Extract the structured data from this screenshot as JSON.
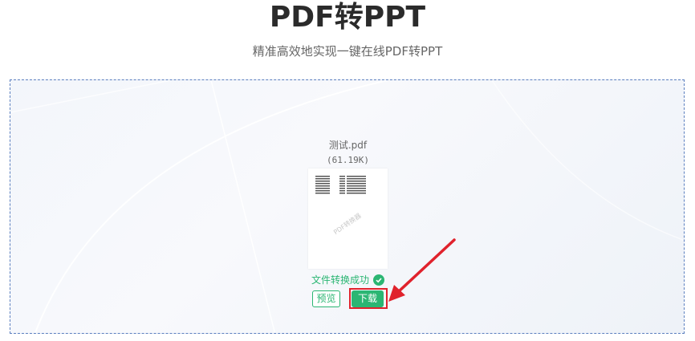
{
  "header": {
    "title": "PDF转PPT",
    "subtitle": "精准高效地实现一键在线PDF转PPT"
  },
  "file": {
    "name": "测试.pdf",
    "size": "(61.19K)",
    "watermark": "PDF转换器"
  },
  "status": {
    "text": "文件转换成功"
  },
  "actions": {
    "preview_label": "预览",
    "download_label": "下载"
  },
  "colors": {
    "accent_green": "#2bb673",
    "dashed_border": "#5b7fbf",
    "annotation_red": "#e0222c"
  }
}
